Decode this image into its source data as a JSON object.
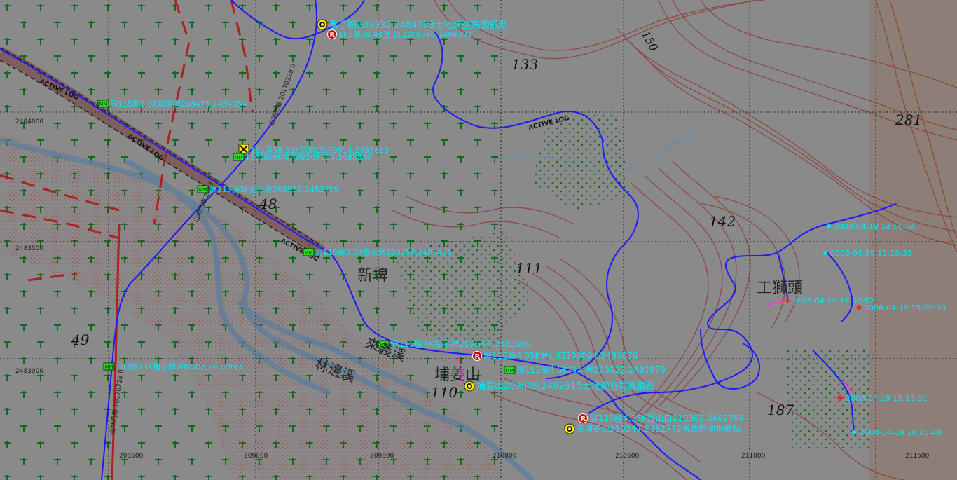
{
  "map": {
    "grid_x_labels": [
      "208500",
      "209000",
      "209500",
      "210000",
      "210500",
      "211000",
      "211500"
    ],
    "grid_y_labels": [
      "2484000",
      "2483500",
      "2483000"
    ],
    "elevation_labels": [
      "133",
      "150",
      "281",
      "142",
      "48",
      "111",
      "49",
      "110",
      "187"
    ],
    "place_labels": [
      "新埤",
      "工獅頭",
      "埔姜山"
    ],
    "track_name_labels": [
      "ACTIVE LOG",
      "ACTIVE LOG",
      "ACTIVE LOG",
      "ACTIVE LOG"
    ],
    "waypoints": [
      {
        "type": "survey",
        "label": "番子頭209332,2484383土地調查局圖根點"
      },
      {
        "type": "trailhead",
        "label": "185縣58.4K登山口209346,2484331"
      },
      {
        "type": "sign",
        "label": "屏115縣2.5K指示牌208475,2484054"
      },
      {
        "type": "junction",
        "label": "185縣58.55K岔路口209014,2483868"
      },
      {
        "type": "sign",
        "label": "185縣59K指示牌208990,2483840"
      },
      {
        "type": "sign",
        "label": "屏115縣3K指示牌208856,2483709"
      },
      {
        "type": "sign",
        "label": "屏115縣3.5K指示牌209250,2483451"
      },
      {
        "type": "sign",
        "label": "屏115縣4K指示牌209544,2483085"
      },
      {
        "type": "trailhead",
        "label": "屏115縣4.35K登山口209894,2483036"
      },
      {
        "type": "sign",
        "label": "屏115縣4.5K指示牌210022,2482979"
      },
      {
        "type": "sign",
        "label": "183縣13K指示牌208502,2482993"
      },
      {
        "type": "survey",
        "label": "埔姜山209609,2482915土地調查局圖根點"
      },
      {
        "type": "trailhead",
        "label": "屏115縣4.35K登山口210302,2482784"
      },
      {
        "type": "survey",
        "label": "東埔姜山210247,2482742省政府圖根補點"
      }
    ],
    "track_points": [
      {
        "label": "2008-04-19 14:56:54"
      },
      {
        "label": "2008-04-19 15:18:33"
      },
      {
        "label": "2008-04-19 15:02:52"
      },
      {
        "label": "2008-04-19 15:29:30"
      },
      {
        "label": "2008-04-19 15:13:31"
      },
      {
        "label": "2008-04-19 16:05:48"
      }
    ],
    "road_labels": [
      "山地門鄉 20170228 0",
      "山地門鄉 2017",
      "山地門鄉 20170228 0"
    ],
    "colors": {
      "background": "#8a8a8a",
      "contour": "#8e4040",
      "track": "#1a1aff",
      "waypoint_text": "#00e5ff",
      "grid": "#1c1c1c",
      "vegetation": "#0d6b1e"
    }
  }
}
